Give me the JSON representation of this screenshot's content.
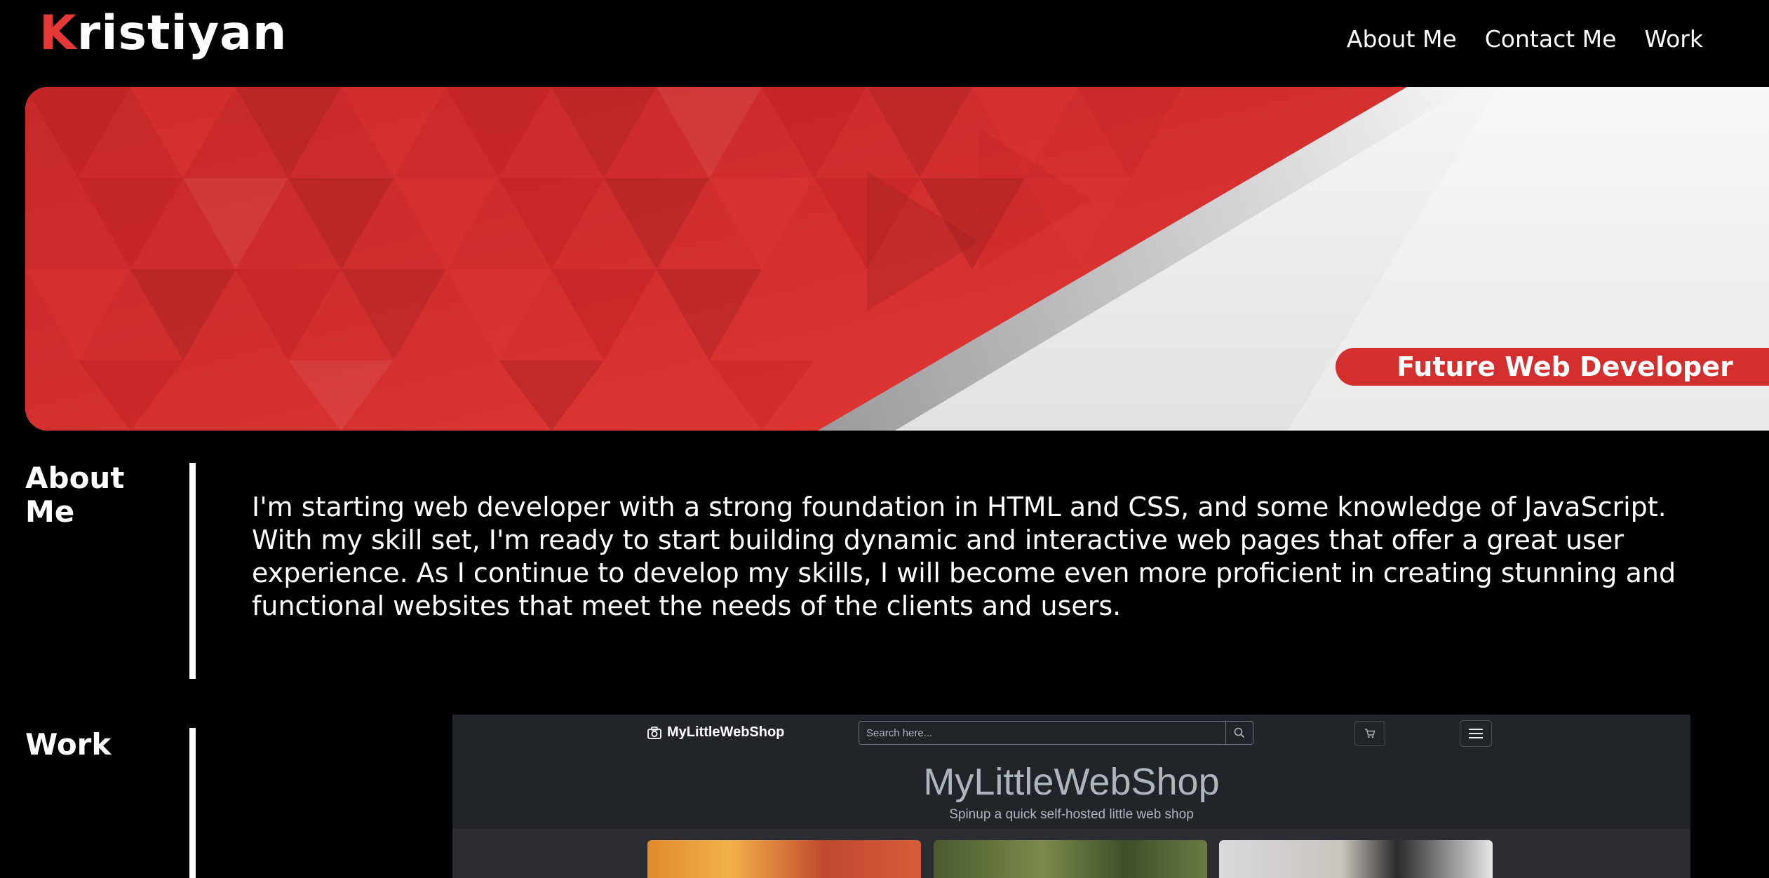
{
  "brand": {
    "first_letter": "K",
    "rest": "ristiyan",
    "accent_color": "#e53935"
  },
  "nav": {
    "items": [
      {
        "label": "About Me"
      },
      {
        "label": "Contact Me"
      },
      {
        "label": "Work"
      }
    ]
  },
  "hero": {
    "tagline": "Future Web Developer",
    "colors": {
      "red": "#d32f2f",
      "light": "#eeeeee"
    }
  },
  "about": {
    "title": "About Me",
    "text": "I'm starting web developer with a strong foundation in HTML and CSS, and some knowledge of JavaScript. With my skill set, I'm ready to start building dynamic and interactive web pages that offer a great user experience. As I continue to develop my skills, I will become even more proficient in creating stunning and functional websites that meet the needs of the clients and users."
  },
  "work": {
    "title": "Work",
    "preview": {
      "brand": "MyLittleWebShop",
      "search_placeholder": "Search here...",
      "title": "MyLittleWebShop",
      "subtitle": "Spinup a quick self-hosted little web shop",
      "icons": [
        "camera-icon",
        "search-icon",
        "cart-icon",
        "menu-icon"
      ]
    }
  }
}
